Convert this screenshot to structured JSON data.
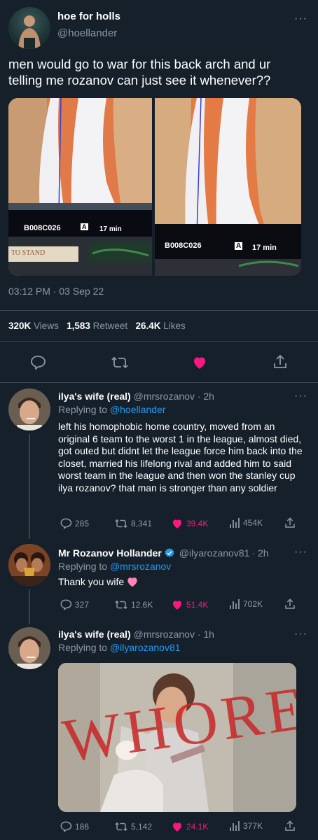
{
  "main_tweet": {
    "display_name": "hoe for holls",
    "handle": "@hoellander",
    "text": "men would go to war for this back arch and ur telling me rozanov can just see it whenever??",
    "photos": [
      {
        "caption_code": "B008C026",
        "caption_badge": "A",
        "caption_time": "17 min",
        "sign_text": "TO STAND"
      },
      {
        "caption_code": "B008C026",
        "caption_badge": "A",
        "caption_time": "17 min"
      }
    ],
    "timestamp": "03:12 PM · 03 Sep 22",
    "stats": {
      "views_value": "320K",
      "views_label": "Views",
      "retweets_value": "1,583",
      "retweets_label": "Retweet",
      "likes_value": "26.4K",
      "likes_label": "Likes"
    },
    "icons": [
      "reply-icon",
      "retweet-icon",
      "heart-icon",
      "share-icon"
    ],
    "accent_like": "#f91880"
  },
  "replies": [
    {
      "display_name": "ilya's wife (real)",
      "handle": "@mrsrozanov",
      "time": "· 2h",
      "replying_prefix": "Replying to",
      "replying_to": "@hoellander",
      "text": "left his homophobic home country, moved from an original 6 team to the worst 1 in the league, almost died, got outed but didnt let the league force him back into the closet, married his lifelong rival and added him to said worst team in the league and then won the stanley cup ilya rozanov? that man is stronger than any soldier",
      "replies": "285",
      "retweets": "8,341",
      "likes": "39.4K",
      "views": "454K"
    },
    {
      "display_name": "Mr Rozanov Hollander",
      "verified": true,
      "handle": "@ilyarozanov81",
      "time": "· 2h",
      "replying_prefix": "Replying to",
      "replying_to": "@mrsrozanov",
      "text": "Thank you wife",
      "replies": "327",
      "retweets": "12.6K",
      "likes": "51.4K",
      "views": "702K"
    },
    {
      "display_name": "ilya's wife (real)",
      "handle": "@mrsrozanov",
      "time": "· 1h",
      "replying_prefix": "Replying to",
      "replying_to": "@ilyarozanov81",
      "image_scrawl": "WHORE",
      "replies": "186",
      "retweets": "5,142",
      "likes": "24.1K",
      "views": "377K"
    }
  ]
}
